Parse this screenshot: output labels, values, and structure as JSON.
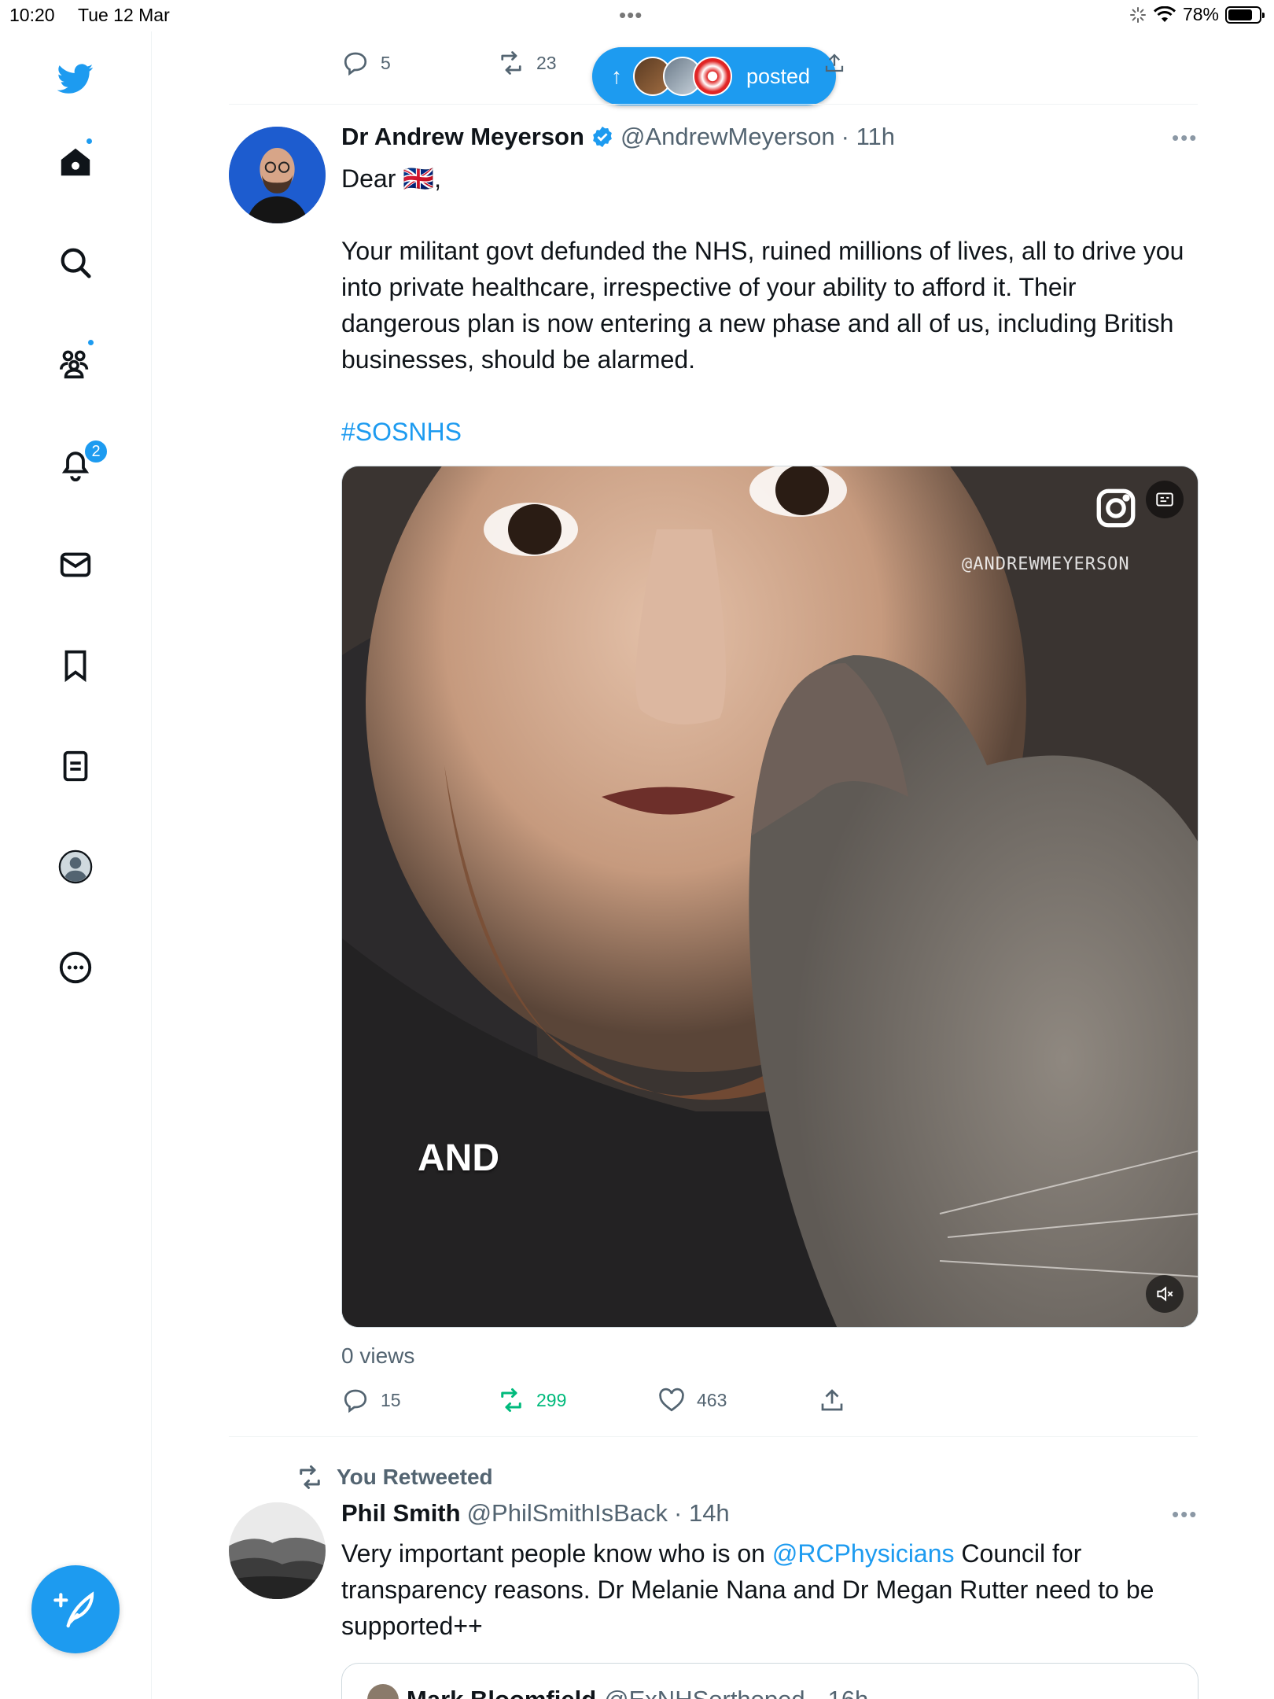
{
  "status_bar": {
    "time": "10:20",
    "date": "Tue 12 Mar",
    "battery": "78%",
    "battery_level": 0.78
  },
  "sidebar": {
    "items": [
      {
        "name": "home",
        "has_dot": true
      },
      {
        "name": "explore"
      },
      {
        "name": "communities",
        "has_dot": true
      },
      {
        "name": "notifications",
        "badge": "2"
      },
      {
        "name": "messages"
      },
      {
        "name": "bookmarks"
      },
      {
        "name": "lists"
      },
      {
        "name": "profile"
      },
      {
        "name": "more"
      }
    ]
  },
  "prev_tweet_actions": {
    "replies": "5",
    "retweets": "23"
  },
  "posted_pill": {
    "label": "posted"
  },
  "tweet1": {
    "name": "Dr Andrew Meyerson",
    "handle": "@AndrewMeyerson",
    "time": "· 11h",
    "greeting": "Dear 🇬🇧,",
    "body": "Your militant govt defunded the NHS, ruined millions of lives, all to drive you into private healthcare, irrespective of your ability to afford it. Their dangerous plan is now entering a new phase and all of us, including British businesses, should be alarmed.",
    "hashtag": "#SOSNHS",
    "video_caption": "AND",
    "video_watermark": "@ANDREWMEYERSON",
    "views": "0 views",
    "replies": "15",
    "retweets": "299",
    "likes": "463"
  },
  "retweet_context": {
    "label": "You Retweeted"
  },
  "tweet2": {
    "name": "Phil Smith",
    "handle": "@PhilSmithIsBack",
    "time": "· 14h",
    "text_before_mention": "Very important people know who is on ",
    "mention": "@RCPhysicians",
    "text_after_mention": " Council for transparency reasons. Dr Melanie Nana and Dr Megan Rutter need to be supported++"
  },
  "quoted_tweet": {
    "name": "Mark Bloomfield",
    "handle": "@ExNHSorthoped",
    "time": "· 16h"
  },
  "colors": {
    "accent": "#1d9bf0",
    "retweet_green": "#00ba7c",
    "secondary_text": "#536471"
  }
}
